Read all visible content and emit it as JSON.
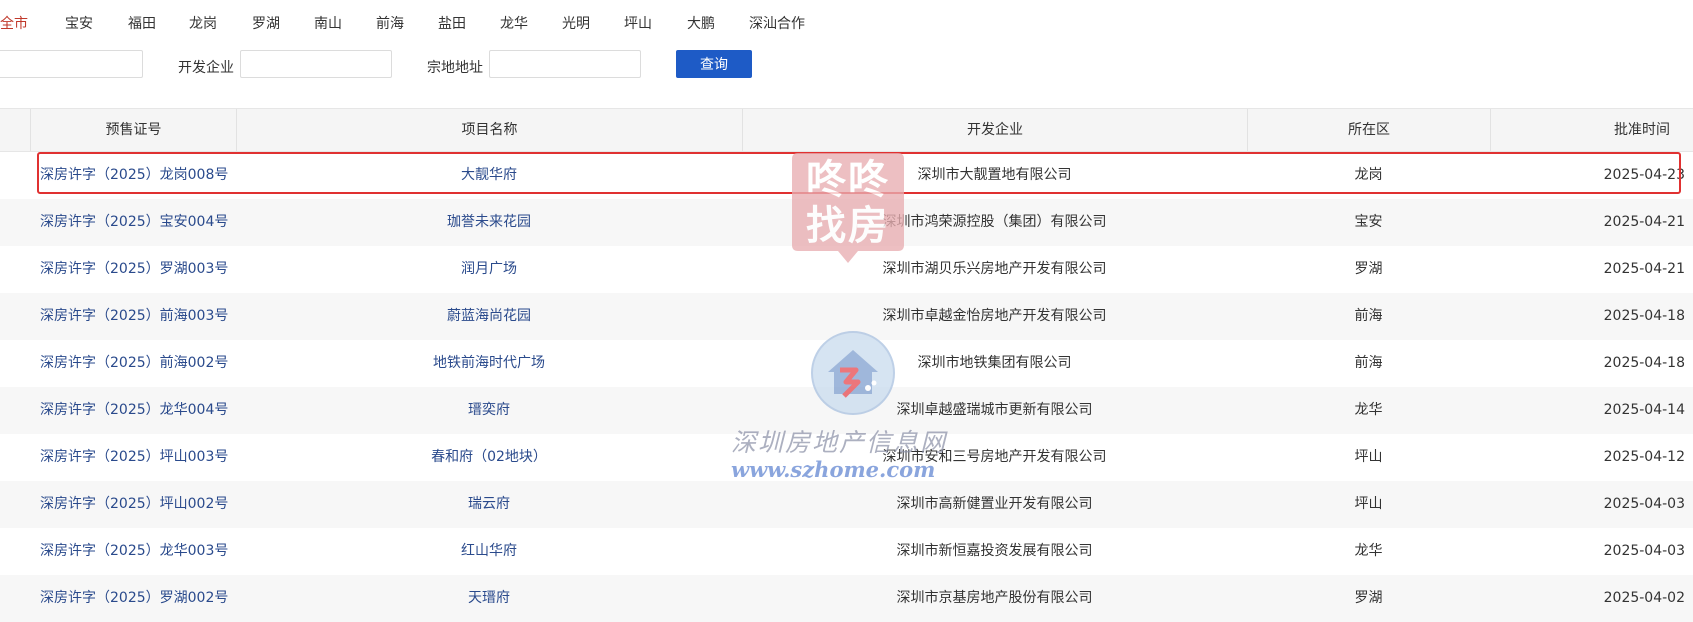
{
  "districts": [
    "全市",
    "宝安",
    "福田",
    "龙岗",
    "罗湖",
    "南山",
    "前海",
    "盐田",
    "龙华",
    "光明",
    "坪山",
    "大鹏",
    "深汕合作"
  ],
  "active_district": "全市",
  "search": {
    "developer_label": "开发企业",
    "address_label": "宗地地址",
    "query_button": "查询",
    "input1_value": "",
    "developer_value": "",
    "address_value": ""
  },
  "table": {
    "headers": [
      "预售证号",
      "项目名称",
      "开发企业",
      "所在区",
      "批准时间"
    ],
    "rows": [
      {
        "permit": "深房许字（2025）龙岗008号",
        "name": "大靓华府",
        "developer": "深圳市大靓置地有限公司",
        "district": "龙岗",
        "date": "2025-04-23"
      },
      {
        "permit": "深房许字（2025）宝安004号",
        "name": "珈誉未来花园",
        "developer": "深圳市鸿荣源控股（集团）有限公司",
        "district": "宝安",
        "date": "2025-04-21"
      },
      {
        "permit": "深房许字（2025）罗湖003号",
        "name": "润月广场",
        "developer": "深圳市湖贝乐兴房地产开发有限公司",
        "district": "罗湖",
        "date": "2025-04-21"
      },
      {
        "permit": "深房许字（2025）前海003号",
        "name": "蔚蓝海尚花园",
        "developer": "深圳市卓越金怡房地产开发有限公司",
        "district": "前海",
        "date": "2025-04-18"
      },
      {
        "permit": "深房许字（2025）前海002号",
        "name": "地铁前海时代广场",
        "developer": "深圳市地铁集团有限公司",
        "district": "前海",
        "date": "2025-04-18"
      },
      {
        "permit": "深房许字（2025）龙华004号",
        "name": "瑨奕府",
        "developer": "深圳卓越盛瑞城市更新有限公司",
        "district": "龙华",
        "date": "2025-04-14"
      },
      {
        "permit": "深房许字（2025）坪山003号",
        "name": "春和府（02地块）",
        "developer": "深圳市安和三号房地产开发有限公司",
        "district": "坪山",
        "date": "2025-04-12"
      },
      {
        "permit": "深房许字（2025）坪山002号",
        "name": "瑞云府",
        "developer": "深圳市高新健置业开发有限公司",
        "district": "坪山",
        "date": "2025-04-03"
      },
      {
        "permit": "深房许字（2025）龙华003号",
        "name": "红山华府",
        "developer": "深圳市新恒嘉投资发展有限公司",
        "district": "龙华",
        "date": "2025-04-03"
      },
      {
        "permit": "深房许字（2025）罗湖002号",
        "name": "天瑨府",
        "developer": "深圳市京基房地产股份有限公司",
        "district": "罗湖",
        "date": "2025-04-02"
      }
    ]
  },
  "watermarks": {
    "brand_line1": "咚咚",
    "brand_line2": "找房",
    "site_name": "深圳房地产信息网",
    "site_url": "www.szhome.com"
  }
}
